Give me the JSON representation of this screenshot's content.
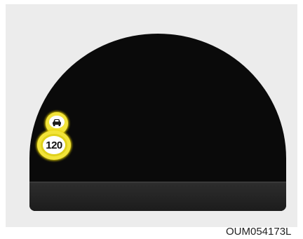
{
  "display": {
    "speed_limit_value": "120",
    "vehicle_sign_icon": "car-front-icon",
    "accent_color": "#f2e43a",
    "cluster_color": "#0a0a0a"
  },
  "figure": {
    "code": "OUM054173L"
  }
}
